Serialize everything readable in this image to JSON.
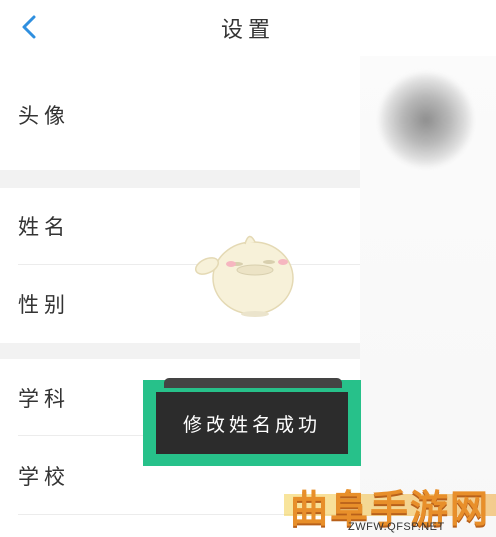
{
  "header": {
    "title": "设置"
  },
  "sections": {
    "avatar_label": "头像",
    "name_label": "姓名",
    "gender_label": "性别",
    "subject_label": "学科",
    "school_label": "学校"
  },
  "toast": {
    "message": "修改姓名成功"
  },
  "watermark": {
    "brand": "曲阜手游网",
    "url": "ZWFW.QFSP.NET"
  },
  "colors": {
    "accent_blue": "#2f8fdf",
    "toast_border": "#27c18a",
    "toast_bg": "#2c2c2c",
    "watermark": "#e88f2a"
  },
  "icons": {
    "back": "chevron-left-icon",
    "mascot": "mascot-sticker"
  }
}
